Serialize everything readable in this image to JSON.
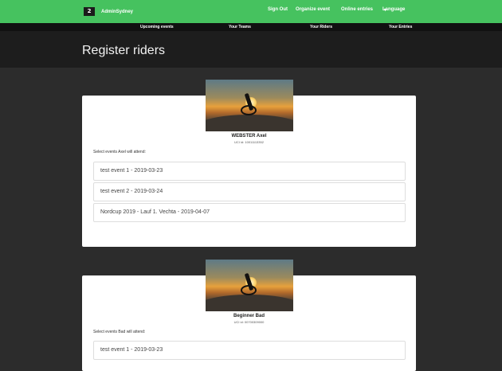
{
  "topnav": {
    "brand_logo": "2",
    "brand_name": "AdminSydney",
    "links": [
      "Sign Out",
      "Organize event",
      "Online entries"
    ],
    "language_label": "Language"
  },
  "subnav": {
    "items": [
      "Upcoming events",
      "Your Teams",
      "Your Riders",
      "Your Entries"
    ]
  },
  "page": {
    "title": "Register riders"
  },
  "riders": [
    {
      "name": "WEBSTER Axel",
      "uci": "UCI id: 10011113352",
      "select_label": "Select events Axel will attend:",
      "events": [
        "test event 1 - 2019-03-23",
        "test event 2 - 2019-03-24",
        "Nordcup 2019 - Lauf 1. Vechta - 2019-04-07"
      ]
    },
    {
      "name": "Beginner Bad",
      "uci": "UCI id: 00700309000",
      "select_label": "Select events Bad will attend:",
      "events": [
        "test event 1 - 2019-03-23"
      ]
    }
  ],
  "colors": {
    "nav_green": "#46c25f",
    "subnav_bg": "#111111",
    "header_bg": "#1d1d1d",
    "page_bg": "#2c2c2c"
  }
}
